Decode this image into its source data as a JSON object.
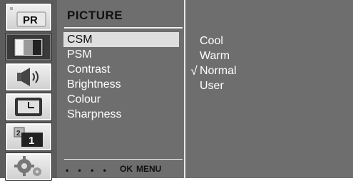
{
  "icons": [
    {
      "name": "pr-icon",
      "text": "PR"
    },
    {
      "name": "picture-icon"
    },
    {
      "name": "speaker-icon"
    },
    {
      "name": "clock-icon"
    },
    {
      "name": "pip-icon",
      "small_text": "2",
      "big_text": "1"
    },
    {
      "name": "gear-icon"
    }
  ],
  "menu": {
    "title": "PICTURE",
    "items": [
      "CSM",
      "PSM",
      "Contrast",
      "Brightness",
      "Colour",
      "Sharpness"
    ],
    "selected_index": 0,
    "footer_dots": "• • • •",
    "footer_ok": "OK",
    "footer_menu": "MENU"
  },
  "options": {
    "items": [
      "Cool",
      "Warm",
      "Normal",
      "User"
    ],
    "checked_index": 2,
    "check_mark": "√"
  },
  "colors": {
    "panel_bg": "#6e6e6e",
    "highlight_bg": "#dedede",
    "text": "#ffffff"
  }
}
